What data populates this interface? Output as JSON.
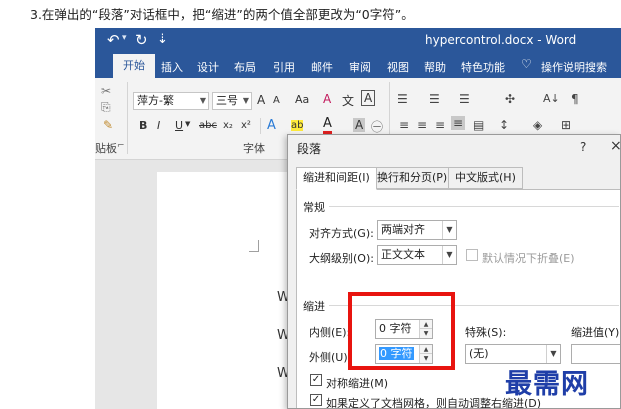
{
  "instruction": "3.在弹出的“段落”对话框中，把“缩进”的两个值全部更改为“0字符”。",
  "window": {
    "title": "hypercontrol.docx - Word",
    "undo_glyph": "↶",
    "redo_glyph": "↻",
    "qat_more": "⇣"
  },
  "tabs": [
    "开始",
    "插入",
    "设计",
    "布局",
    "引用",
    "邮件",
    "审阅",
    "视图",
    "帮助",
    "特色功能",
    "操作说明搜索"
  ],
  "ribbon": {
    "font_name": "萍方-繁",
    "font_size": "三号",
    "grow_font": "A",
    "shrink_font": "A",
    "change_case": "Aa",
    "clear_format": "A",
    "phonetic": "文",
    "char_border": "A",
    "bold": "B",
    "italic": "I",
    "underline": "U",
    "strikethrough": "abc",
    "subscript": "x₂",
    "superscript": "x²",
    "text_effects": "A",
    "highlight": "ab",
    "font_color": "A",
    "char_shading": "A",
    "enclose": "㊀",
    "sort": "A↓",
    "show_marks": "¶",
    "font_group_label": "字体",
    "clipboard_group_label": "贴板",
    "group_launcher": "⌐"
  },
  "document": {
    "lines": [
      "W",
      "W",
      "W"
    ]
  },
  "dialog": {
    "title": "段落",
    "help": "?",
    "close": "×",
    "tabs": [
      "缩进和间距(I)",
      "换行和分页(P)",
      "中文版式(H)"
    ],
    "general": {
      "heading": "常规",
      "alignment_label": "对齐方式(G):",
      "alignment_value": "两端对齐",
      "outline_label": "大纲级别(O):",
      "outline_value": "正文文本",
      "collapsed_label": "默认情况下折叠(E)"
    },
    "indent": {
      "heading": "缩进",
      "inner_label": "内侧(E):",
      "inner_value": "0 字符",
      "outer_label": "外侧(U):",
      "outer_value": "0 字符",
      "special_label": "特殊(S):",
      "special_value": "(无)",
      "by_label": "缩进值(Y):",
      "by_value": "",
      "mirror_label": "对称缩进(M)",
      "auto_adjust_label": "如果定义了文档网格，则自动调整右缩进(D)"
    }
  },
  "highlight_color": "#e8140f",
  "watermark": "最需网"
}
